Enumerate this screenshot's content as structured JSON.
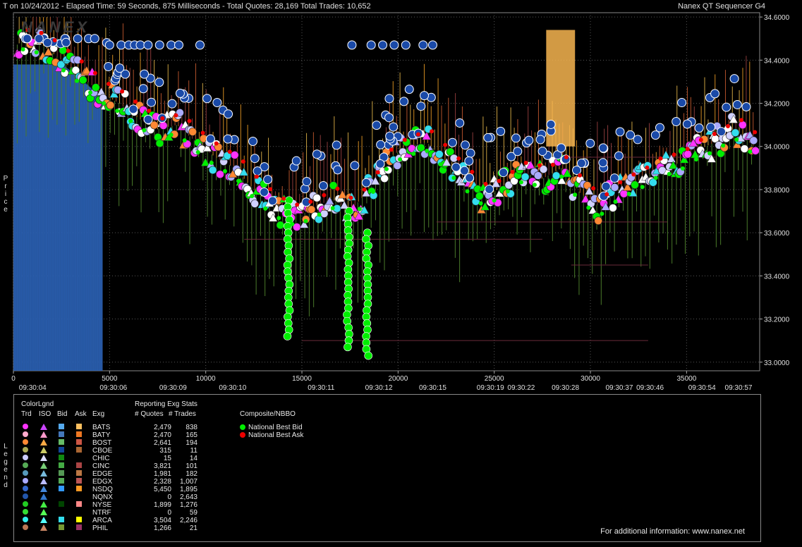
{
  "header": {
    "left_text": "T on 10/24/2012  -  Elapsed Time: 59 Seconds, 875 Milliseconds  -  Total Quotes: 28,169  Total Trades: 10,652",
    "right_text": "Nanex QT Sequencer G4",
    "watermark": "NANEX"
  },
  "axis_labels": {
    "price": "Price",
    "legend": "Legend"
  },
  "chart_data": {
    "type": "scatter",
    "x_ticks": [
      0,
      5000,
      10000,
      15000,
      20000,
      25000,
      30000,
      35000
    ],
    "time_labels": [
      {
        "x": 1000,
        "label": "09:30:04"
      },
      {
        "x": 5200,
        "label": "09:30:06"
      },
      {
        "x": 8300,
        "label": "09:30:09"
      },
      {
        "x": 11400,
        "label": "09:30:10"
      },
      {
        "x": 16000,
        "label": "09:30:11"
      },
      {
        "x": 19000,
        "label": "09:30:12"
      },
      {
        "x": 21800,
        "label": "09:30:15"
      },
      {
        "x": 24800,
        "label": "09:30:19"
      },
      {
        "x": 26400,
        "label": "09:30:22"
      },
      {
        "x": 28700,
        "label": "09:30:28"
      },
      {
        "x": 31500,
        "label": "09:30:37"
      },
      {
        "x": 33100,
        "label": "09:30:46"
      },
      {
        "x": 35800,
        "label": "09:30:54"
      },
      {
        "x": 37700,
        "label": "09:30:57"
      }
    ],
    "y_ticks": [
      33.0,
      33.2,
      33.4,
      33.6,
      33.8,
      34.0,
      34.2,
      34.4,
      34.6
    ],
    "y_tick_labels": [
      "33.0000",
      "33.2000",
      "33.4000",
      "33.6000",
      "33.8000",
      "34.0000",
      "34.2000",
      "34.4000",
      "34.6000"
    ],
    "xlim": [
      0,
      38800
    ],
    "ylim": [
      32.96,
      34.62
    ],
    "grid": true,
    "price_path": [
      [
        0,
        34.46
      ],
      [
        500,
        34.49
      ],
      [
        1500,
        34.47
      ],
      [
        2500,
        34.4
      ],
      [
        3500,
        34.33
      ],
      [
        4500,
        34.25
      ],
      [
        5500,
        34.2
      ],
      [
        6500,
        34.13
      ],
      [
        7500,
        34.08
      ],
      [
        8500,
        34.1
      ],
      [
        9500,
        34.02
      ],
      [
        10500,
        33.95
      ],
      [
        11500,
        33.9
      ],
      [
        12500,
        33.8
      ],
      [
        13500,
        33.72
      ],
      [
        14500,
        33.68
      ],
      [
        15500,
        33.7
      ],
      [
        16500,
        33.76
      ],
      [
        17500,
        33.7
      ],
      [
        18500,
        33.8
      ],
      [
        19500,
        33.95
      ],
      [
        20500,
        34.0
      ],
      [
        21500,
        34.02
      ],
      [
        22500,
        33.93
      ],
      [
        23500,
        33.84
      ],
      [
        24500,
        33.76
      ],
      [
        25500,
        33.82
      ],
      [
        26500,
        33.88
      ],
      [
        27500,
        33.85
      ],
      [
        28500,
        33.9
      ],
      [
        29500,
        33.78
      ],
      [
        30500,
        33.72
      ],
      [
        31500,
        33.8
      ],
      [
        32500,
        33.84
      ],
      [
        33500,
        33.9
      ],
      [
        34500,
        33.92
      ],
      [
        35500,
        33.98
      ],
      [
        36500,
        34.02
      ],
      [
        37500,
        34.08
      ],
      [
        38500,
        34.0
      ]
    ],
    "series": [
      {
        "name": "National Best Bid",
        "color": "#00ee00"
      },
      {
        "name": "National Best Ask",
        "color": "#ee0000"
      }
    ]
  },
  "legend": {
    "headers": {
      "colorlgnd": "ColorLgnd",
      "trd": "Trd",
      "iso": "ISO",
      "bid": "Bid",
      "ask": "Ask",
      "exg": "Exg",
      "stats": "Reporting Exg Stats",
      "quotes": "# Quotes",
      "trades": "# Trades",
      "composite": "Composite/NBBO"
    },
    "rows": [
      {
        "exg": "BATS",
        "quotes": "2,479",
        "trades": "838",
        "trd": "#ff33ff",
        "iso": "#cc44ff",
        "bid": "#55aaee",
        "ask": "#ffc060"
      },
      {
        "exg": "BATY",
        "quotes": "2,470",
        "trades": "165",
        "trd": "#ffaacc",
        "iso": "#ff99cc",
        "bid": "#4477bb",
        "ask": "#ee7722"
      },
      {
        "exg": "BOST",
        "quotes": "2,641",
        "trades": "194",
        "trd": "#ff8833",
        "iso": "#ffaa44",
        "bid": "#66bb66",
        "ask": "#cc5544"
      },
      {
        "exg": "CBOE",
        "quotes": "315",
        "trades": "11",
        "trd": "#aaaa55",
        "iso": "#cccc66",
        "bid": "#114499",
        "ask": "#aa6633"
      },
      {
        "exg": "CHIC",
        "quotes": "15",
        "trades": "14",
        "trd": "#ccccff",
        "iso": "#ddddff",
        "bid": "#118811",
        "ask": "#000000"
      },
      {
        "exg": "CINC",
        "quotes": "3,821",
        "trades": "101",
        "trd": "#55aa55",
        "iso": "#77cc77",
        "bid": "#44aa44",
        "ask": "#aa4444"
      },
      {
        "exg": "EDGE",
        "quotes": "1,981",
        "trades": "182",
        "trd": "#5599bb",
        "iso": "#77bbdd",
        "bid": "#559955",
        "ask": "#bb7744"
      },
      {
        "exg": "EDGX",
        "quotes": "2,328",
        "trades": "1,007",
        "trd": "#aaaaff",
        "iso": "#bbbbff",
        "bid": "#55aa55",
        "ask": "#bb5555"
      },
      {
        "exg": "NSDQ",
        "quotes": "5,450",
        "trades": "1,895",
        "trd": "#3366cc",
        "iso": "#4488dd",
        "bid": "#3399ff",
        "ask": "#ff9922"
      },
      {
        "exg": "NQNX",
        "quotes": "0",
        "trades": "2,643",
        "trd": "#2255aa",
        "iso": "#3377cc",
        "bid": "#000000",
        "ask": "#000000"
      },
      {
        "exg": "NYSE",
        "quotes": "1,899",
        "trades": "1,276",
        "trd": "#22cc22",
        "iso": "#44ee44",
        "bid": "#004400",
        "ask": "#ff8888"
      },
      {
        "exg": "NTRF",
        "quotes": "0",
        "trades": "59",
        "trd": "#33dd33",
        "iso": "#55ff55",
        "bid": "#000000",
        "ask": "#000000"
      },
      {
        "exg": "ARCA",
        "quotes": "3,504",
        "trades": "2,246",
        "trd": "#33eeee",
        "iso": "#55ffff",
        "bid": "#33ddee",
        "ask": "#ffff00"
      },
      {
        "exg": "PHIL",
        "quotes": "1,266",
        "trades": "21",
        "trd": "#bb7755",
        "iso": "#cc8866",
        "bid": "#779933",
        "ask": "#993366"
      }
    ]
  },
  "nbbo": [
    {
      "label": "National Best Bid",
      "color": "#00ee00"
    },
    {
      "label": "National Best Ask",
      "color": "#ee0000"
    }
  ],
  "footer": "For additional information: www.nanex.net"
}
